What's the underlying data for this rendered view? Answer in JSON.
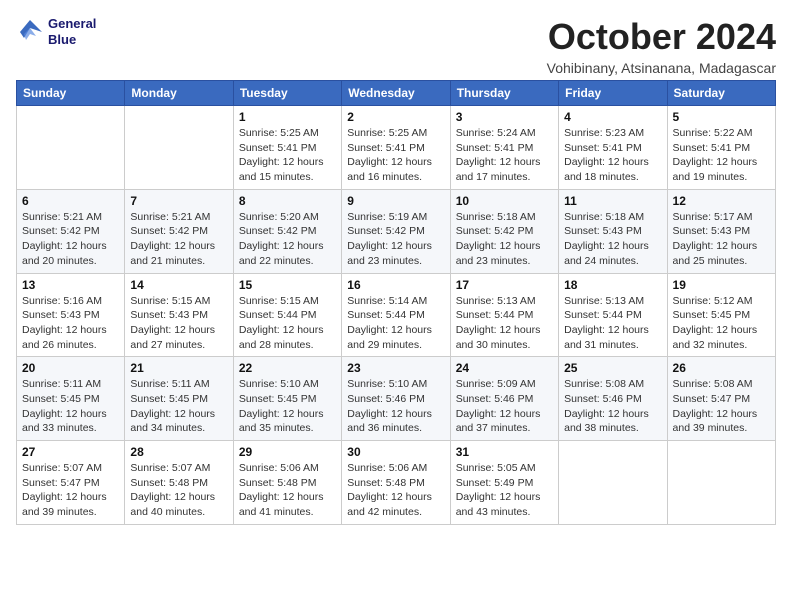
{
  "header": {
    "logo_line1": "General",
    "logo_line2": "Blue",
    "title": "October 2024",
    "location": "Vohibinany, Atsinanana, Madagascar"
  },
  "weekdays": [
    "Sunday",
    "Monday",
    "Tuesday",
    "Wednesday",
    "Thursday",
    "Friday",
    "Saturday"
  ],
  "weeks": [
    [
      {
        "day": "",
        "info": ""
      },
      {
        "day": "",
        "info": ""
      },
      {
        "day": "1",
        "info": "Sunrise: 5:25 AM\nSunset: 5:41 PM\nDaylight: 12 hours and 15 minutes."
      },
      {
        "day": "2",
        "info": "Sunrise: 5:25 AM\nSunset: 5:41 PM\nDaylight: 12 hours and 16 minutes."
      },
      {
        "day": "3",
        "info": "Sunrise: 5:24 AM\nSunset: 5:41 PM\nDaylight: 12 hours and 17 minutes."
      },
      {
        "day": "4",
        "info": "Sunrise: 5:23 AM\nSunset: 5:41 PM\nDaylight: 12 hours and 18 minutes."
      },
      {
        "day": "5",
        "info": "Sunrise: 5:22 AM\nSunset: 5:41 PM\nDaylight: 12 hours and 19 minutes."
      }
    ],
    [
      {
        "day": "6",
        "info": "Sunrise: 5:21 AM\nSunset: 5:42 PM\nDaylight: 12 hours and 20 minutes."
      },
      {
        "day": "7",
        "info": "Sunrise: 5:21 AM\nSunset: 5:42 PM\nDaylight: 12 hours and 21 minutes."
      },
      {
        "day": "8",
        "info": "Sunrise: 5:20 AM\nSunset: 5:42 PM\nDaylight: 12 hours and 22 minutes."
      },
      {
        "day": "9",
        "info": "Sunrise: 5:19 AM\nSunset: 5:42 PM\nDaylight: 12 hours and 23 minutes."
      },
      {
        "day": "10",
        "info": "Sunrise: 5:18 AM\nSunset: 5:42 PM\nDaylight: 12 hours and 23 minutes."
      },
      {
        "day": "11",
        "info": "Sunrise: 5:18 AM\nSunset: 5:43 PM\nDaylight: 12 hours and 24 minutes."
      },
      {
        "day": "12",
        "info": "Sunrise: 5:17 AM\nSunset: 5:43 PM\nDaylight: 12 hours and 25 minutes."
      }
    ],
    [
      {
        "day": "13",
        "info": "Sunrise: 5:16 AM\nSunset: 5:43 PM\nDaylight: 12 hours and 26 minutes."
      },
      {
        "day": "14",
        "info": "Sunrise: 5:15 AM\nSunset: 5:43 PM\nDaylight: 12 hours and 27 minutes."
      },
      {
        "day": "15",
        "info": "Sunrise: 5:15 AM\nSunset: 5:44 PM\nDaylight: 12 hours and 28 minutes."
      },
      {
        "day": "16",
        "info": "Sunrise: 5:14 AM\nSunset: 5:44 PM\nDaylight: 12 hours and 29 minutes."
      },
      {
        "day": "17",
        "info": "Sunrise: 5:13 AM\nSunset: 5:44 PM\nDaylight: 12 hours and 30 minutes."
      },
      {
        "day": "18",
        "info": "Sunrise: 5:13 AM\nSunset: 5:44 PM\nDaylight: 12 hours and 31 minutes."
      },
      {
        "day": "19",
        "info": "Sunrise: 5:12 AM\nSunset: 5:45 PM\nDaylight: 12 hours and 32 minutes."
      }
    ],
    [
      {
        "day": "20",
        "info": "Sunrise: 5:11 AM\nSunset: 5:45 PM\nDaylight: 12 hours and 33 minutes."
      },
      {
        "day": "21",
        "info": "Sunrise: 5:11 AM\nSunset: 5:45 PM\nDaylight: 12 hours and 34 minutes."
      },
      {
        "day": "22",
        "info": "Sunrise: 5:10 AM\nSunset: 5:45 PM\nDaylight: 12 hours and 35 minutes."
      },
      {
        "day": "23",
        "info": "Sunrise: 5:10 AM\nSunset: 5:46 PM\nDaylight: 12 hours and 36 minutes."
      },
      {
        "day": "24",
        "info": "Sunrise: 5:09 AM\nSunset: 5:46 PM\nDaylight: 12 hours and 37 minutes."
      },
      {
        "day": "25",
        "info": "Sunrise: 5:08 AM\nSunset: 5:46 PM\nDaylight: 12 hours and 38 minutes."
      },
      {
        "day": "26",
        "info": "Sunrise: 5:08 AM\nSunset: 5:47 PM\nDaylight: 12 hours and 39 minutes."
      }
    ],
    [
      {
        "day": "27",
        "info": "Sunrise: 5:07 AM\nSunset: 5:47 PM\nDaylight: 12 hours and 39 minutes."
      },
      {
        "day": "28",
        "info": "Sunrise: 5:07 AM\nSunset: 5:48 PM\nDaylight: 12 hours and 40 minutes."
      },
      {
        "day": "29",
        "info": "Sunrise: 5:06 AM\nSunset: 5:48 PM\nDaylight: 12 hours and 41 minutes."
      },
      {
        "day": "30",
        "info": "Sunrise: 5:06 AM\nSunset: 5:48 PM\nDaylight: 12 hours and 42 minutes."
      },
      {
        "day": "31",
        "info": "Sunrise: 5:05 AM\nSunset: 5:49 PM\nDaylight: 12 hours and 43 minutes."
      },
      {
        "day": "",
        "info": ""
      },
      {
        "day": "",
        "info": ""
      }
    ]
  ]
}
